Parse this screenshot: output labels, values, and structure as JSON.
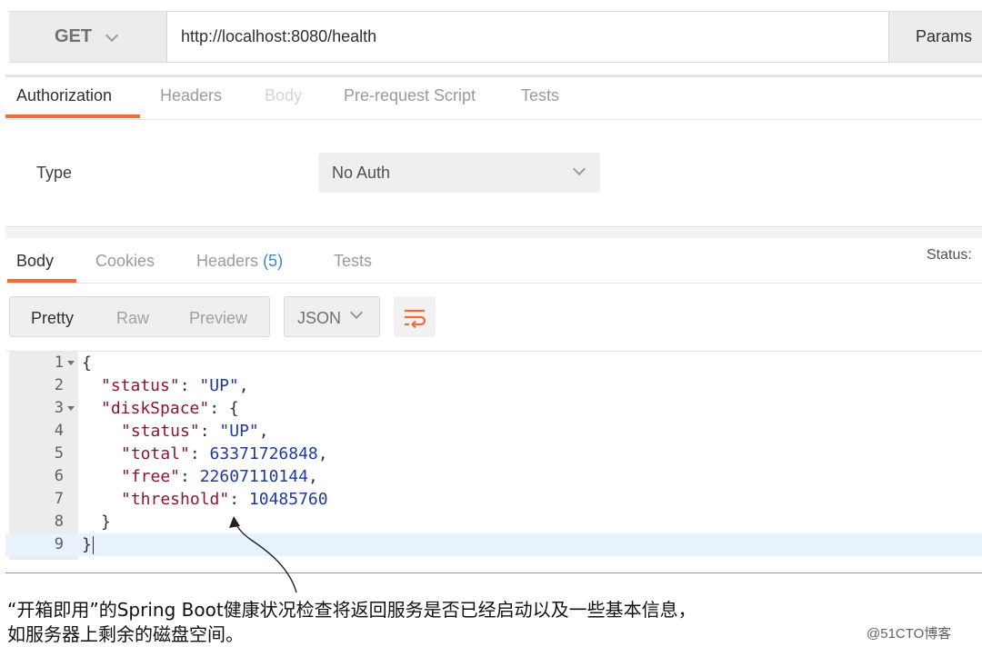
{
  "request": {
    "method": "GET",
    "url": "http://localhost:8080/health",
    "params_label": "Params"
  },
  "request_tabs": [
    {
      "label": "Authorization",
      "state": "active"
    },
    {
      "label": "Headers",
      "state": "normal"
    },
    {
      "label": "Body",
      "state": "disabled"
    },
    {
      "label": "Pre-request Script",
      "state": "normal"
    },
    {
      "label": "Tests",
      "state": "normal"
    }
  ],
  "auth": {
    "type_label": "Type",
    "selected": "No Auth"
  },
  "response_tabs": {
    "body": "Body",
    "cookies": "Cookies",
    "headers": "Headers",
    "headers_count": "(5)",
    "tests": "Tests",
    "status_label": "Status:"
  },
  "view_modes": [
    "Pretty",
    "Raw",
    "Preview"
  ],
  "format": "JSON",
  "code_lines": [
    {
      "n": "1",
      "text": "{"
    },
    {
      "n": "2",
      "key": "\"status\"",
      "sep": ": ",
      "val": "\"UP\"",
      "end": ","
    },
    {
      "n": "3",
      "key": "\"diskSpace\"",
      "sep": ": {",
      "val": "",
      "end": ""
    },
    {
      "n": "4",
      "key": "\"status\"",
      "sep": ": ",
      "val": "\"UP\"",
      "end": ","
    },
    {
      "n": "5",
      "key": "\"total\"",
      "sep": ": ",
      "val": "63371726848",
      "end": ","
    },
    {
      "n": "6",
      "key": "\"free\"",
      "sep": ": ",
      "val": "22607110144",
      "end": ","
    },
    {
      "n": "7",
      "key": "\"threshold\"",
      "sep": ": ",
      "val": "10485760",
      "end": ""
    },
    {
      "n": "8",
      "text": "}"
    },
    {
      "n": "9",
      "text": "}"
    }
  ],
  "caption": {
    "line1": "“开箱即用”的Spring Boot健康状况检查将返回服务是否已经启动以及一些基本信息，",
    "line2": "如服务器上剩余的磁盘空间。"
  },
  "watermark": "@51CTO博客",
  "colors": {
    "accent": "#f26b3a",
    "json_key": "#8a1538",
    "json_value": "#1e3aa0",
    "count": "#3b86c7"
  }
}
